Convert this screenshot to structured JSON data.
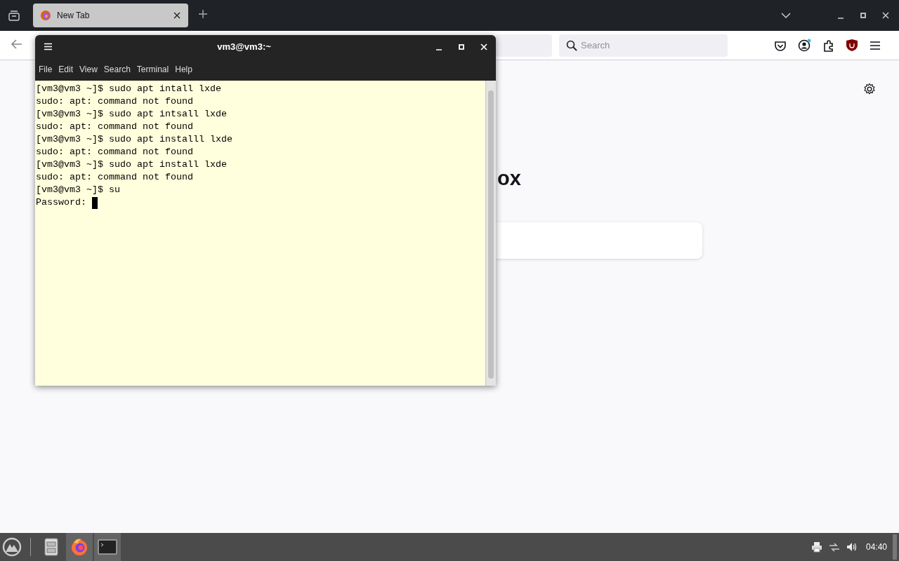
{
  "browser": {
    "tabs": [
      {
        "title": "New Tab",
        "selected": true
      }
    ],
    "search": {
      "placeholder": "Search"
    },
    "page": {
      "heading": "ox"
    }
  },
  "terminal": {
    "title": "vm3@vm3:~",
    "menu": [
      "File",
      "Edit",
      "View",
      "Search",
      "Terminal",
      "Help"
    ],
    "lines": [
      "[vm3@vm3 ~]$ sudo apt intall lxde",
      "sudo: apt: command not found",
      "[vm3@vm3 ~]$ sudo apt intsall lxde",
      "sudo: apt: command not found",
      "[vm3@vm3 ~]$ sudo apt installl lxde",
      "sudo: apt: command not found",
      "[vm3@vm3 ~]$ sudo apt install lxde",
      "sudo: apt: command not found",
      "[vm3@vm3 ~]$ su",
      "Password: "
    ]
  },
  "taskbar": {
    "apps": [
      {
        "kind": "files",
        "active": false
      },
      {
        "kind": "browser",
        "active": true
      },
      {
        "kind": "terminal",
        "active": true
      }
    ],
    "clock": "04:40"
  }
}
